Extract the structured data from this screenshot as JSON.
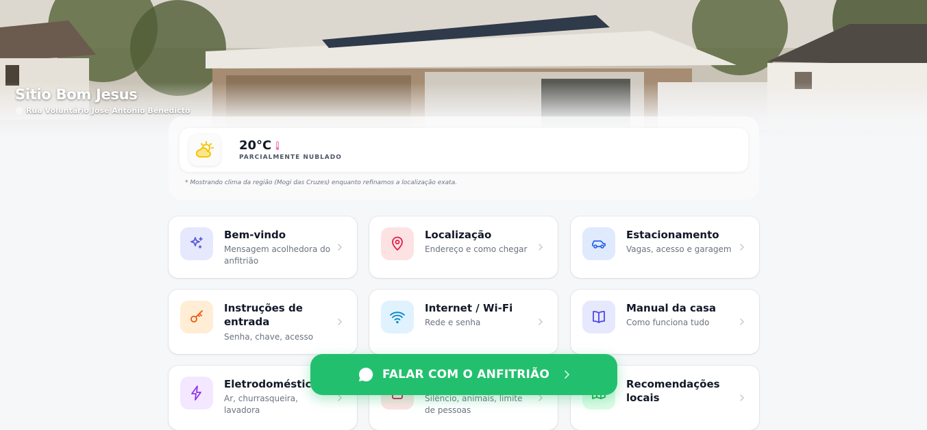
{
  "hero": {
    "title": "Sitio Bom Jesus",
    "address": "Rua Voluntário José Antônio Benedicto"
  },
  "weather": {
    "temperature": "20°C",
    "description": "PARCIALMENTE NUBLADO",
    "note": "* Mostrando clima da região (Mogi das Cruzes) enquanto refinamos a localização exata."
  },
  "cards": [
    {
      "title": "Bem-vindo",
      "subtitle": "Mensagem acolhedora do anfitrião",
      "icon": "sparkles-icon",
      "icon_bg": "#e6e8fd",
      "icon_color": "#5b5bd6"
    },
    {
      "title": "Localização",
      "subtitle": "Endereço e como chegar",
      "icon": "map-pin-icon",
      "icon_bg": "#fde2e4",
      "icon_color": "#e11d48"
    },
    {
      "title": "Estacionamento",
      "subtitle": "Vagas, acesso e garagem",
      "icon": "car-icon",
      "icon_bg": "#e0eafd",
      "icon_color": "#2563eb"
    },
    {
      "title": "Instruções de entrada",
      "subtitle": "Senha, chave, acesso",
      "icon": "key-icon",
      "icon_bg": "#ffedd5",
      "icon_color": "#ea580c"
    },
    {
      "title": "Internet / Wi-Fi",
      "subtitle": "Rede e senha",
      "icon": "wifi-icon",
      "icon_bg": "#e0f2fe",
      "icon_color": "#0284c7"
    },
    {
      "title": "Manual da casa",
      "subtitle": "Como funciona tudo",
      "icon": "book-icon",
      "icon_bg": "#e6e8fd",
      "icon_color": "#4f46e5"
    },
    {
      "title": "Eletrodomésticos",
      "subtitle": "Ar, churrasqueira, lavadora",
      "icon": "lightning-icon",
      "icon_bg": "#f3e8ff",
      "icon_color": "#9333ea"
    },
    {
      "title": "",
      "subtitle": "Silêncio, animais, limite de pessoas",
      "icon": "rules-icon",
      "icon_bg": "#fde2e4",
      "icon_color": "#be123c"
    },
    {
      "title": "Recomendações locais",
      "subtitle": "",
      "icon": "map-icon",
      "icon_bg": "#dcfce7",
      "icon_color": "#16a34a"
    }
  ],
  "cta": {
    "label": "FALAR COM O ANFITRIÃO"
  },
  "colors": {
    "accent_green": "#22c06e",
    "text_dark": "#111827",
    "text_muted": "#6b7280"
  }
}
